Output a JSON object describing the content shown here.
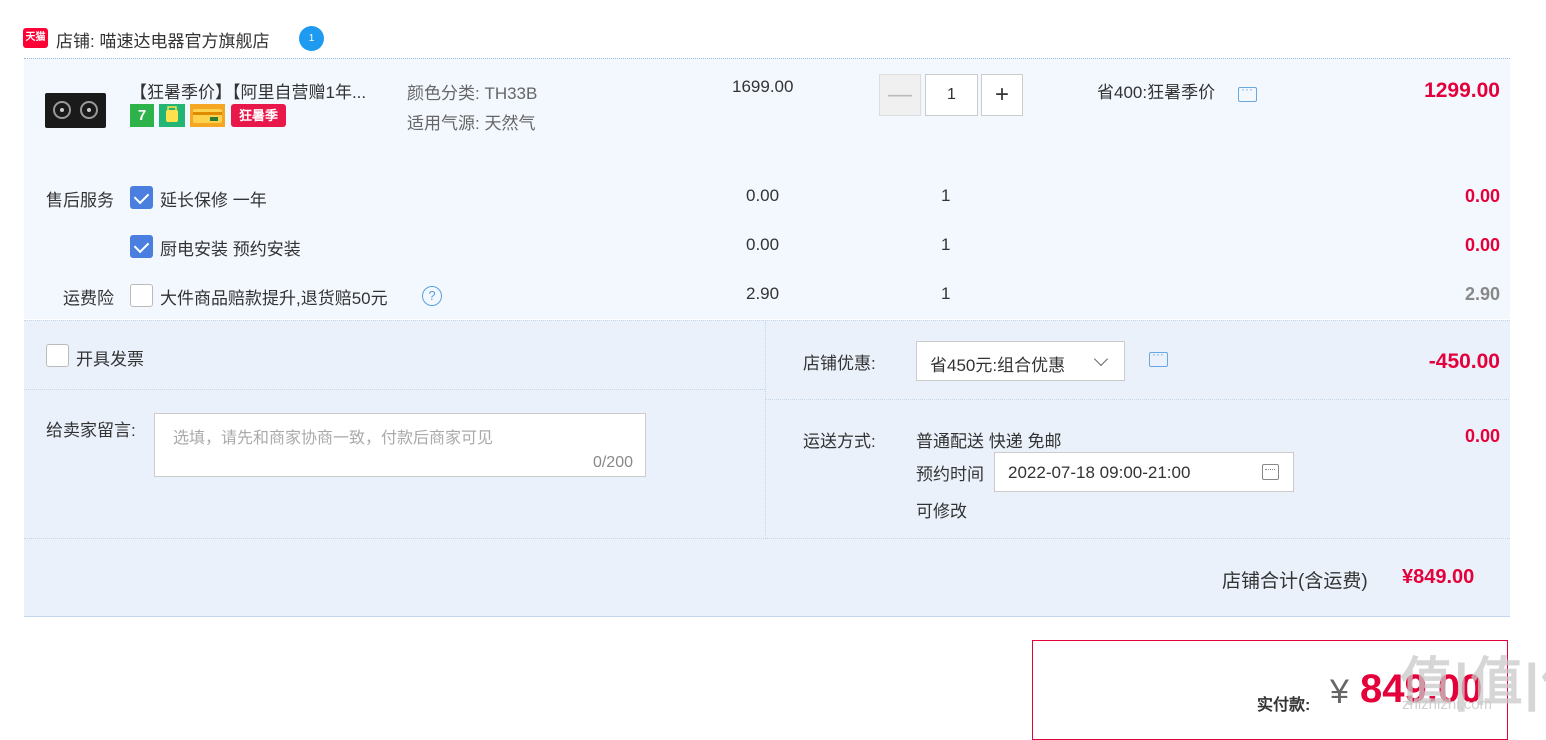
{
  "shop": {
    "logo_text": "天猫",
    "label": "店铺: 喵速达电器官方旗舰店",
    "chat_badge": "1"
  },
  "item": {
    "title": "【狂暑季价】【阿里自营赠1年...",
    "badges": [
      "7",
      "",
      "",
      "狂暑季"
    ],
    "sku_color": "颜色分类:  TH33B",
    "sku_gas": "适用气源:  天然气",
    "unit_price": "1699.00",
    "quantity": "1",
    "minus": "—",
    "plus": "+",
    "promo": "省400:狂暑季价",
    "subtotal": "1299.00"
  },
  "services": {
    "after_sale_label": "售后服务",
    "rows": [
      {
        "label": "延长保修 一年",
        "price": "0.00",
        "qty": "1",
        "total": "0.00",
        "checked": true
      },
      {
        "label": "厨电安装 预约安装",
        "price": "0.00",
        "qty": "1",
        "total": "0.00",
        "checked": true
      }
    ],
    "freight_label": "运费险",
    "freight": {
      "label": "大件商品赔款提升,退货赔50元",
      "price": "2.90",
      "qty": "1",
      "total": "2.90",
      "checked": false,
      "help": "?"
    }
  },
  "invoice": {
    "label": "开具发票"
  },
  "message": {
    "label": "给卖家留言:",
    "placeholder": "选填，请先和商家协商一致，付款后商家可见",
    "counter": "0/200"
  },
  "discount": {
    "label": "店铺优惠:",
    "selected": "省450元:组合优惠",
    "amount": "-450.00"
  },
  "shipping": {
    "label": "运送方式:",
    "method": "普通配送 快递 免邮",
    "fee": "0.00",
    "appointment_label": "预约时间",
    "appointment_value": "2022-07-18 09:00-21:00",
    "note": "可修改"
  },
  "total": {
    "label": "店铺合计(含运费)",
    "value": "¥849.00"
  },
  "payment": {
    "label": "实付款:",
    "currency": "¥",
    "amount": "849.00"
  },
  "watermark": {
    "main": "值|值|值",
    "sub": "zhizhizhi.com"
  }
}
